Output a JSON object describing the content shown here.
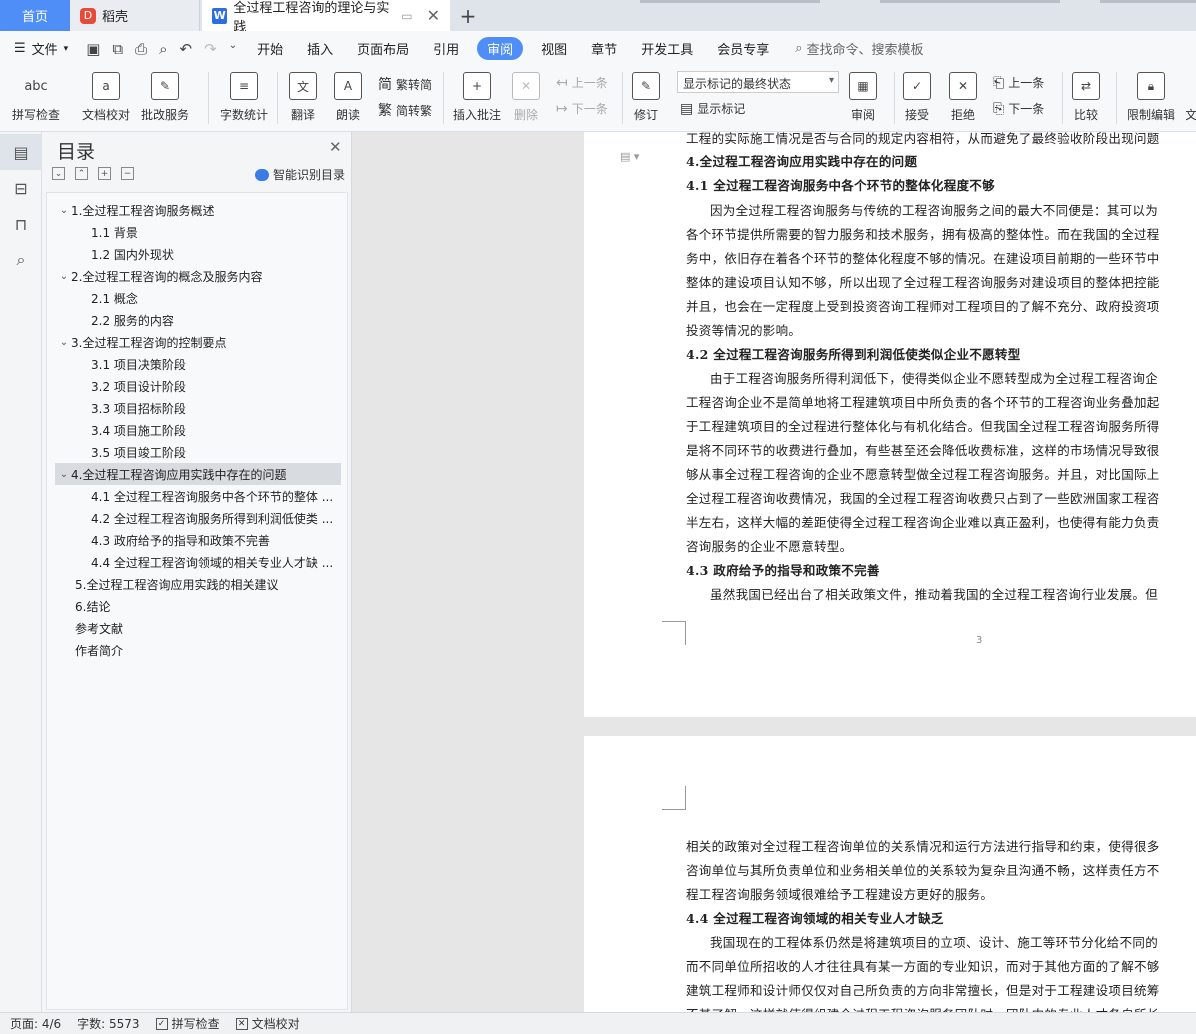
{
  "tabs": {
    "home": "首页",
    "daoke": "稻壳",
    "active_doc": "全过程工程咨询的理论与实践"
  },
  "menu": {
    "file": "文件",
    "items": [
      "开始",
      "插入",
      "页面布局",
      "引用",
      "审阅",
      "视图",
      "章节",
      "开发工具",
      "会员专享"
    ],
    "active": "审阅",
    "search_placeholder": "查找命令、搜索模板"
  },
  "ribbon": {
    "spell_check": "拼写检查",
    "doc_proof": "文档校对",
    "batch_service": "批改服务",
    "word_count": "字数统计",
    "translate": "翻译",
    "read_aloud": "朗读",
    "trad_to_simp": "繁转简",
    "simp_to_trad": "简转繁",
    "insert_comment": "插入批注",
    "delete": "删除",
    "prev_comment": "上一条",
    "next_comment": "下一条",
    "track_changes": "修订",
    "markup_select": "显示标记的最终状态",
    "show_markup": "显示标记",
    "review": "审阅",
    "accept": "接受",
    "reject": "拒绝",
    "prev_change": "上一条",
    "next_change": "下一条",
    "compare": "比较",
    "restrict_edit": "限制编辑",
    "cut_text": "文"
  },
  "toc": {
    "title": "目录",
    "ai_label": "智能识别目录",
    "items": [
      "1.全过程工程咨询服务概述",
      "1.1 背景",
      "1.2 国内外现状",
      "2.全过程工程咨询的概念及服务内容",
      "2.1 概念",
      "2.2 服务的内容",
      "3.全过程工程咨询的控制要点",
      "3.1 项目决策阶段",
      "3.2 项目设计阶段",
      "3.3 项目招标阶段",
      "3.4 项目施工阶段",
      "3.5 项目竣工阶段",
      "4.全过程工程咨询应用实践中存在的问题",
      "4.1 全过程工程咨询服务中各个环节的整体 ...",
      "4.2 全过程工程咨询服务所得到利润低使类 ...",
      "4.3 政府给予的指导和政策不完善",
      "4.4 全过程工程咨询领域的相关专业人才缺 ...",
      "5.全过程工程咨询应用实践的相关建议",
      "6.结论",
      "参考文献",
      "作者简介"
    ]
  },
  "doc": {
    "page1_lines": [
      "工程的实际施工情况是否与合同的规定内容相符，从而避免了最终验收阶段出现问题",
      "4.全过程工程咨询应用实践中存在的问题",
      "4.1 全过程工程咨询服务中各个环节的整体化程度不够",
      "因为全过程工程咨询服务与传统的工程咨询服务之间的最大不同便是：其可以为",
      "各个环节提供所需要的智力服务和技术服务，拥有极高的整体性。而在我国的全过程",
      "务中，依旧存在着各个环节的整体化程度不够的情况。在建设项目前期的一些环节中",
      "整体的建设项目认知不够，所以出现了全过程工程咨询服务对建设项目的整体把控能",
      "并且，也会在一定程度上受到投资咨询工程师对工程项目的了解不充分、政府投资项",
      "投资等情况的影响。",
      "4.2 全过程工程咨询服务所得到利润低使类似企业不愿转型",
      "由于工程咨询服务所得利润低下，使得类似企业不愿转型成为全过程工程咨询企",
      "工程咨询企业不是简单地将工程建筑项目中所负责的各个环节的工程咨询业务叠加起",
      "于工程建筑项目的全过程进行整体化与有机化结合。但我国全过程工程咨询服务所得",
      "是将不同环节的收费进行叠加，有些甚至还会降低收费标准，这样的市场情况导致很",
      "够从事全过程工程咨询的企业不愿意转型做全过程工程咨询服务。并且，对比国际上",
      "全过程工程咨询收费情况，我国的全过程工程咨询收费只占到了一些欧洲国家工程咨",
      "半左右，这样大幅的差距使得全过程工程咨询企业难以真正盈利，也使得有能力负责",
      "咨询服务的企业不愿意转型。",
      "4.3 政府给予的指导和政策不完善",
      "虽然我国已经出台了相关政策文件，推动着我国的全过程工程咨询行业发展。但"
    ],
    "page_number": "3",
    "page2_lines": [
      "相关的政策对全过程工程咨询单位的关系情况和运行方法进行指导和约束，使得很多",
      "咨询单位与其所负责单位和业务相关单位的关系较为复杂且沟通不畅，这样责任方不",
      "程工程咨询服务领域很难给予工程建设方更好的服务。",
      "4.4 全过程工程咨询领域的相关专业人才缺乏",
      "我国现在的工程体系仍然是将建筑项目的立项、设计、施工等环节分化给不同的",
      "而不同单位所招收的人才往往具有某一方面的专业知识，而对于其他方面的了解不够",
      "建筑工程师和设计师仅仅对自己所负责的方向非常擅长，但是对于工程建设项目统筹",
      "不甚了解，这样就使得组建全过程工程咨询服务团队时，团队中的专业人才各自所长"
    ]
  },
  "status": {
    "page": "页面: 4/6",
    "words": "字数: 5573",
    "spell": "拼写检查",
    "proof": "文档校对"
  }
}
